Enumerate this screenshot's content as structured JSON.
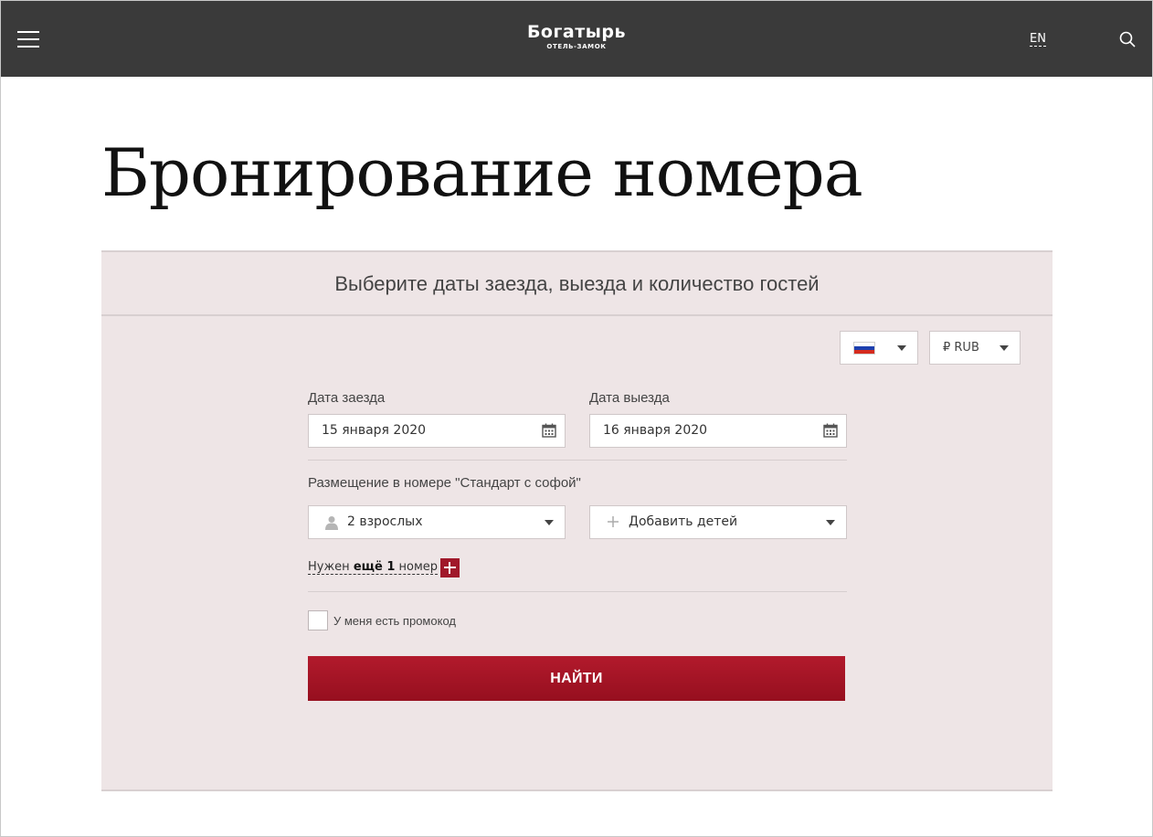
{
  "header": {
    "logo_main": "Богатырь",
    "logo_sub": "ОТЕЛЬ-ЗАМОК",
    "lang": "EN"
  },
  "page": {
    "title": "Бронирование номера"
  },
  "booking": {
    "heading": "Выберите даты заезда, выезда и количество гостей",
    "currency": "₽ RUB",
    "checkin_label": "Дата заезда",
    "checkin_value": "15 января 2020",
    "checkout_label": "Дата выезда",
    "checkout_value": "16 января 2020",
    "room_label": "Размещение в номере \"Стандарт с софой\"",
    "adults_value": "2 взрослых",
    "children_value": "Добавить детей",
    "need_room_prefix": "Нужен ",
    "need_room_bold": "ещё 1",
    "need_room_suffix": " номер",
    "promo_label": "У меня есть промокод",
    "find_button": "НАЙТИ"
  },
  "colors": {
    "header_bg": "#3a3a3a",
    "panel_bg": "#eee5e6",
    "accent": "#a0182a"
  }
}
